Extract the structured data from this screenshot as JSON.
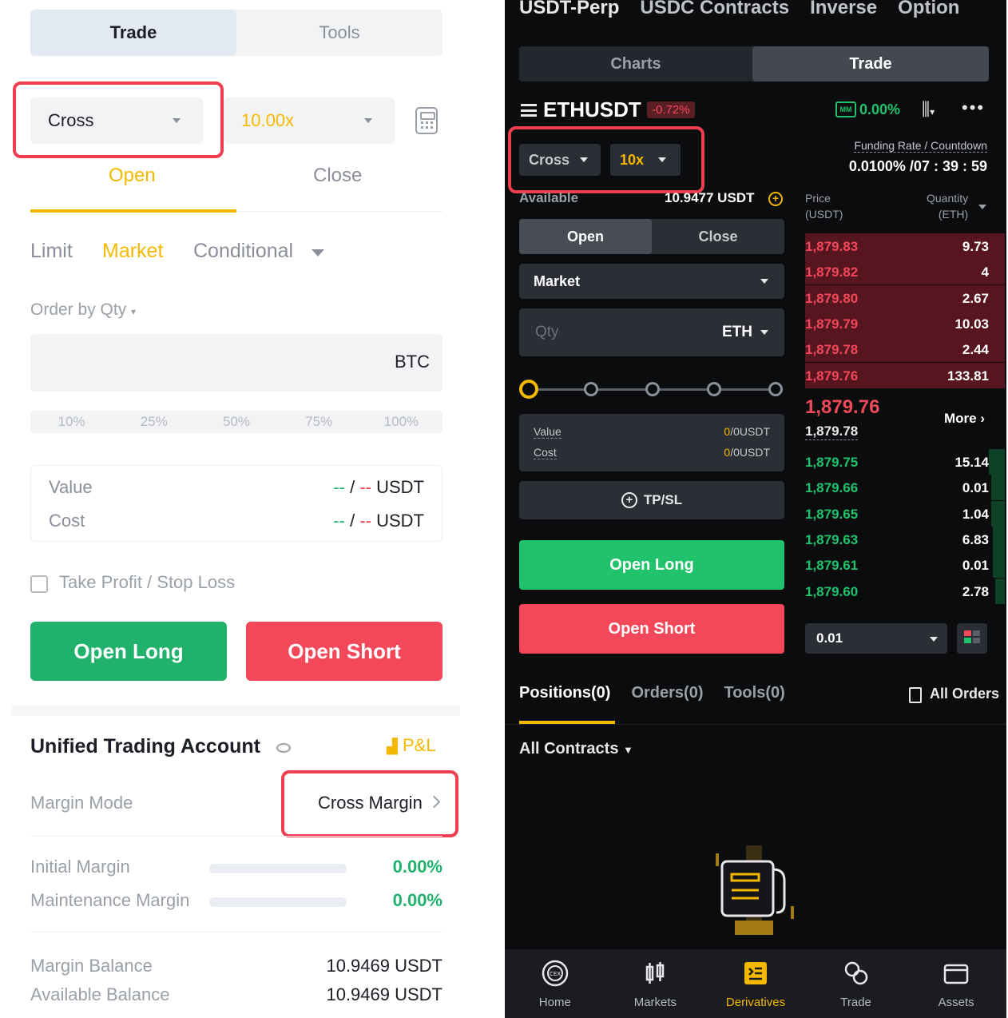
{
  "left": {
    "seg_tabs": [
      "Trade",
      "Tools"
    ],
    "margin_mode": "Cross",
    "leverage": "10.00x",
    "tabs": [
      "Open",
      "Close"
    ],
    "order_types": [
      "Limit",
      "Market",
      "Conditional"
    ],
    "order_by": "Order by Qty",
    "qty_unit": "BTC",
    "percent_steps": [
      "10%",
      "25%",
      "50%",
      "75%",
      "100%"
    ],
    "value_label": "Value",
    "cost_label": "Cost",
    "value_a": "--",
    "value_sep": "/",
    "value_b": "--",
    "value_unit": "USDT",
    "tpsl_label": "Take Profit / Stop Loss",
    "open_long": "Open Long",
    "open_short": "Open Short",
    "account_title": "Unified Trading Account",
    "pnl_label": "P&L",
    "margin_mode_label": "Margin Mode",
    "margin_mode_value": "Cross Margin",
    "initial_margin_label": "Initial Margin",
    "initial_margin_value": "0.00%",
    "maint_margin_label": "Maintenance Margin",
    "maint_margin_value": "0.00%",
    "margin_balance_label": "Margin Balance",
    "margin_balance_value": "10.9469 USDT",
    "available_balance_label": "Available Balance",
    "available_balance_value": "10.9469 USDT"
  },
  "right": {
    "top_nav": [
      "USDT-Perp",
      "USDC Contracts",
      "Inverse",
      "Option"
    ],
    "seg_tabs": [
      "Charts",
      "Trade"
    ],
    "symbol": "ETHUSDT",
    "change": "-0.72%",
    "mm_badge": "MM",
    "mm_value": "0.00%",
    "margin_mode": "Cross",
    "leverage": "10x",
    "funding_label": "Funding Rate / Countdown",
    "funding_value": "0.0100% /07 : 39 : 59",
    "available_label": "Available",
    "available_value": "10.9477 USDT",
    "open_close": [
      "Open",
      "Close"
    ],
    "order_type": "Market",
    "qty_placeholder": "Qty",
    "qty_unit": "ETH",
    "value_label": "Value",
    "cost_label": "Cost",
    "value_zero": "0",
    "value_rest": "/0USDT",
    "tpsl": "TP/SL",
    "open_long": "Open Long",
    "open_short": "Open Short",
    "ob_price_head": [
      "Price",
      "(USDT)"
    ],
    "ob_qty_head": [
      "Quantity",
      "(ETH)"
    ],
    "asks": [
      {
        "price": "1,879.83",
        "qty": "9.73",
        "depth": 1.0
      },
      {
        "price": "1,879.82",
        "qty": "4",
        "depth": 1.0
      },
      {
        "price": "1,879.80",
        "qty": "2.67",
        "depth": 1.0
      },
      {
        "price": "1,879.79",
        "qty": "10.03",
        "depth": 1.0
      },
      {
        "price": "1,879.78",
        "qty": "2.44",
        "depth": 1.0
      },
      {
        "price": "1,879.76",
        "qty": "133.81",
        "depth": 1.0
      }
    ],
    "last_price": "1,879.76",
    "mark_price": "1,879.78",
    "more": "More",
    "bids": [
      {
        "price": "1,879.75",
        "qty": "15.14",
        "depth": 0.08
      },
      {
        "price": "1,879.66",
        "qty": "0.01",
        "depth": 0.07
      },
      {
        "price": "1,879.65",
        "qty": "1.04",
        "depth": 0.07
      },
      {
        "price": "1,879.63",
        "qty": "6.83",
        "depth": 0.06
      },
      {
        "price": "1,879.61",
        "qty": "0.01",
        "depth": 0.06
      },
      {
        "price": "1,879.60",
        "qty": "2.78",
        "depth": 0.05
      }
    ],
    "ob_step": "0.01",
    "position_tabs": [
      "Positions(0)",
      "Orders(0)",
      "Tools(0)"
    ],
    "all_orders": "All Orders",
    "all_contracts": "All Contracts",
    "bottom_nav": [
      "Home",
      "Markets",
      "Derivatives",
      "Trade",
      "Assets"
    ],
    "colors": {
      "green": "#20c36b",
      "red": "#f2485a",
      "yellow": "#f5b800"
    }
  }
}
